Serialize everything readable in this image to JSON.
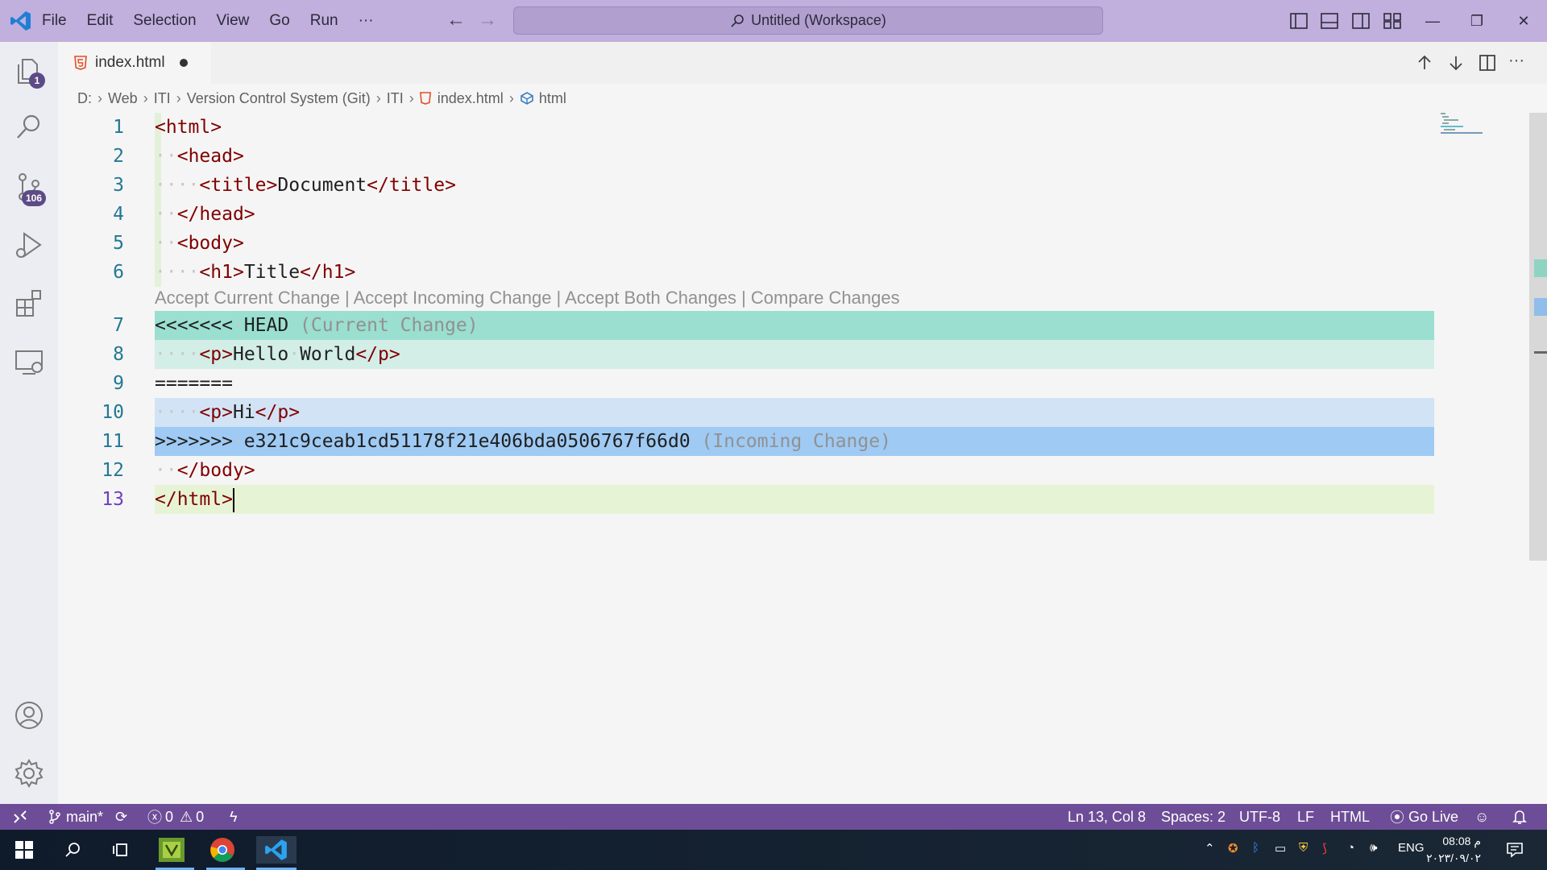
{
  "titlebar": {
    "menu": [
      "File",
      "Edit",
      "Selection",
      "View",
      "Go",
      "Run",
      "···"
    ],
    "search_text": "Untitled (Workspace)"
  },
  "activity": {
    "explorer_badge": "1",
    "scm_badge": "106"
  },
  "tab": {
    "filename": "index.html"
  },
  "breadcrumb": [
    "D:",
    "Web",
    "ITI",
    "Version Control System (Git)",
    "ITI",
    "index.html",
    "html"
  ],
  "codelens": "Accept Current Change | Accept Incoming Change | Accept Both Changes | Compare Changes",
  "line_numbers": [
    "1",
    "2",
    "3",
    "4",
    "5",
    "6",
    "7",
    "8",
    "9",
    "10",
    "11",
    "12",
    "13"
  ],
  "code": {
    "l1_tag": "html",
    "l2_tag": "head",
    "l3_tag": "title",
    "l3_text": "Document",
    "l4_tag": "head",
    "l5_tag": "body",
    "l6_tag": "h1",
    "l6_text": "Title",
    "l7_marker": "<<<<<<<",
    "l7_head": "HEAD",
    "l7_label": "(Current Change)",
    "l8_tag": "p",
    "l8_text1": "Hello",
    "l8_text2": "World",
    "l9_sep": "=======",
    "l10_tag": "p",
    "l10_text": "Hi",
    "l11_marker": ">>>>>>>",
    "l11_hash": "e321c9ceab1cd51178f21e406bda0506767f66d0",
    "l11_label": "(Incoming Change)",
    "l12_tag": "body",
    "l13_tag": "html"
  },
  "colors": {
    "current_header": "#9adfd0",
    "current_body": "#d3ede7",
    "incoming_body": "#d2e3f5",
    "incoming_header": "#9fcaf3",
    "active_line": "#e6f4d5",
    "statusbar": "#6d4d97",
    "titlebar": "#c1afdd"
  },
  "status": {
    "branch": "main*",
    "errors": "0",
    "warnings": "0",
    "position": "Ln 13, Col 8",
    "spaces": "Spaces: 2",
    "encoding": "UTF-8",
    "eol": "LF",
    "language": "HTML",
    "golive": "Go Live"
  },
  "taskbar": {
    "lang": "ENG",
    "time": "08:08 م",
    "date": "٢٠٢٣/٠٩/٠٢"
  }
}
